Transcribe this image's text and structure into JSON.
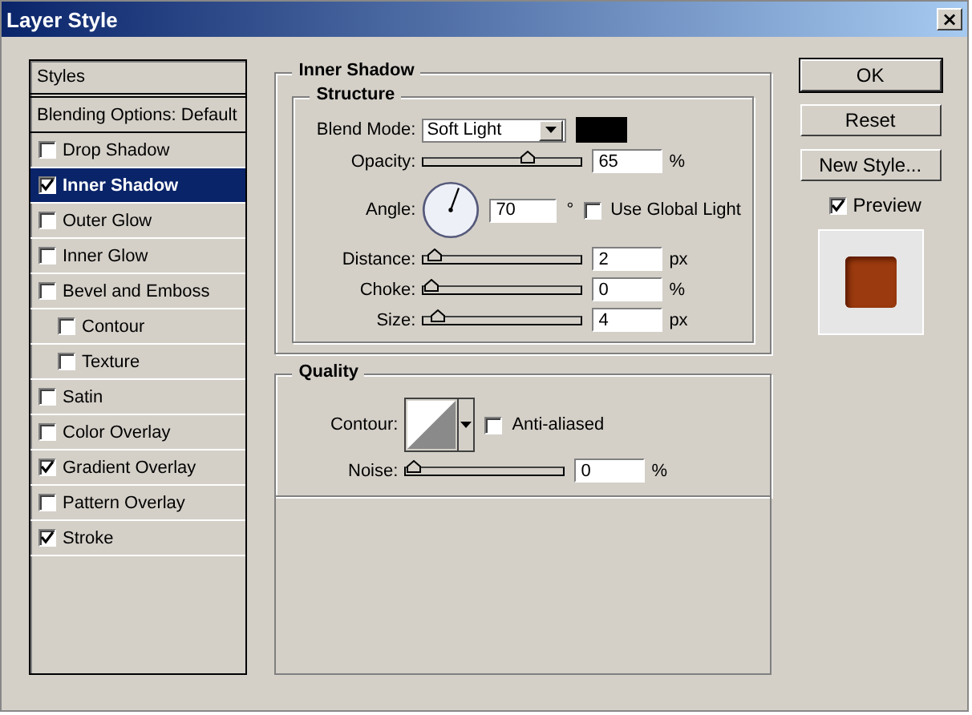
{
  "window": {
    "title": "Layer Style",
    "close": "×"
  },
  "styles_list": {
    "header": "Styles",
    "blending": "Blending Options: Default",
    "items": [
      {
        "label": "Drop Shadow",
        "checked": false,
        "selected": false
      },
      {
        "label": "Inner Shadow",
        "checked": true,
        "selected": true
      },
      {
        "label": "Outer Glow",
        "checked": false,
        "selected": false
      },
      {
        "label": "Inner Glow",
        "checked": false,
        "selected": false
      },
      {
        "label": "Bevel and Emboss",
        "checked": false,
        "selected": false,
        "children": [
          {
            "label": "Contour",
            "checked": false,
            "selected": false
          },
          {
            "label": "Texture",
            "checked": false,
            "selected": false
          }
        ]
      },
      {
        "label": "Satin",
        "checked": false,
        "selected": false
      },
      {
        "label": "Color Overlay",
        "checked": false,
        "selected": false
      },
      {
        "label": "Gradient Overlay",
        "checked": true,
        "selected": false
      },
      {
        "label": "Pattern Overlay",
        "checked": false,
        "selected": false
      },
      {
        "label": "Stroke",
        "checked": true,
        "selected": false
      }
    ]
  },
  "panel": {
    "title": "Inner Shadow",
    "structure": {
      "title": "Structure",
      "blend_mode": {
        "label": "Blend Mode:",
        "value": "Soft Light",
        "color": "#000000"
      },
      "opacity": {
        "label": "Opacity:",
        "level": 0.65,
        "value": "65",
        "unit": "%"
      },
      "angle": {
        "label": "Angle:",
        "value": "70",
        "unit": "°",
        "global_light": {
          "label": "Use Global Light",
          "checked": false
        }
      },
      "sliders": [
        {
          "label": "Distance:",
          "level": 0.02,
          "value": "2",
          "unit": "px"
        },
        {
          "label": "Choke:",
          "level": 0,
          "value": "0",
          "unit": "%"
        },
        {
          "label": "Size:",
          "level": 0.04,
          "value": "4",
          "unit": "px"
        }
      ]
    },
    "quality": {
      "title": "Quality",
      "contour": {
        "label": "Contour:"
      },
      "anti_aliased": {
        "label": "Anti-aliased",
        "checked": false
      },
      "noise": {
        "label": "Noise:",
        "level": 0,
        "value": "0",
        "unit": "%"
      }
    }
  },
  "buttons": [
    {
      "label": "OK",
      "default": true
    },
    {
      "label": "Reset",
      "default": false
    },
    {
      "label": "New Style...",
      "default": false
    }
  ],
  "preview": {
    "label": "Preview",
    "checked": true
  }
}
